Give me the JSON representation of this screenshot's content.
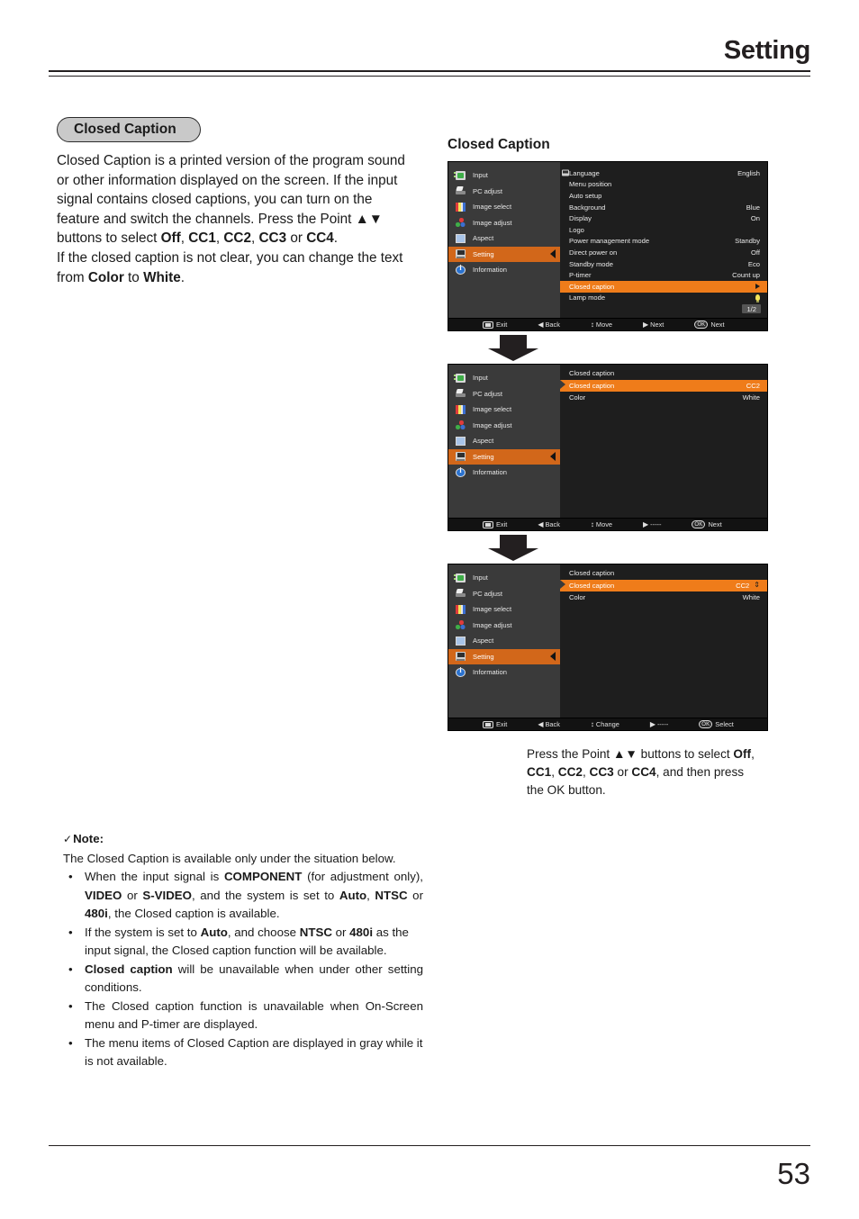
{
  "header": {
    "title": "Setting"
  },
  "footer": {
    "page_number": "53"
  },
  "left": {
    "badge_label": "Closed Caption",
    "paragraph_runs": [
      {
        "t": "Closed Caption is a printed version of the program sound or other information displayed on the screen. If the input signal contains closed captions, you can turn on the feature and switch the channels. Press the Point ",
        "b": false
      },
      {
        "t": "▲▼",
        "b": false
      },
      {
        "t": " buttons to select ",
        "b": false
      },
      {
        "t": "Off",
        "b": true
      },
      {
        "t": ", ",
        "b": false
      },
      {
        "t": "CC1",
        "b": true
      },
      {
        "t": ", ",
        "b": false
      },
      {
        "t": "CC2",
        "b": true
      },
      {
        "t": ", ",
        "b": false
      },
      {
        "t": "CC3",
        "b": true
      },
      {
        "t": " or ",
        "b": false
      },
      {
        "t": "CC4",
        "b": true
      },
      {
        "t": ".",
        "b": false
      }
    ],
    "paragraph_line2": "If the closed caption is not clear, you can change the text from ",
    "paragraph_line2_b1": "Color",
    "paragraph_line2_mid": " to ",
    "paragraph_line2_b2": "White",
    "paragraph_line2_end": "."
  },
  "note": {
    "tick": "✓",
    "heading": "Note:",
    "lead": "The Closed Caption is available only under the situation below.",
    "bullet_glyph": "•",
    "items": [
      {
        "parts": [
          {
            "t": "When the input signal is ",
            "b": false
          },
          {
            "t": "COMPONENT",
            "b": true
          },
          {
            "t": " (for adjustment only),  ",
            "b": false
          },
          {
            "t": "VIDEO",
            "b": true
          },
          {
            "t": " or ",
            "b": false
          },
          {
            "t": "S-VIDEO",
            "b": true
          },
          {
            "t": ", and the system is set to ",
            "b": false
          },
          {
            "t": "Auto",
            "b": true
          },
          {
            "t": ", ",
            "b": false
          },
          {
            "t": "NTSC",
            "b": true
          },
          {
            "t": " or ",
            "b": false
          },
          {
            "t": "480i",
            "b": true
          },
          {
            "t": ", the Closed caption is available.",
            "b": false
          }
        ],
        "justify": true
      },
      {
        "parts": [
          {
            "t": "If the system is set to ",
            "b": false
          },
          {
            "t": "Auto",
            "b": true
          },
          {
            "t": ", and choose ",
            "b": false
          },
          {
            "t": "NTSC",
            "b": true
          },
          {
            "t": " or ",
            "b": false
          },
          {
            "t": "480i",
            "b": true
          },
          {
            "t": " as the input signal, the Closed caption function will be available.",
            "b": false
          }
        ],
        "justify": false
      },
      {
        "parts": [
          {
            "t": "Closed caption",
            "b": true
          },
          {
            "t": " will be unavailable when under other setting conditions.",
            "b": false
          }
        ],
        "justify": true
      },
      {
        "parts": [
          {
            "t": "The Closed caption function is unavailable when On-Screen menu and P-timer are displayed.",
            "b": false
          }
        ],
        "justify": true
      },
      {
        "parts": [
          {
            "t": "The menu items of Closed Caption are displayed in gray while it is not available.",
            "b": false
          }
        ],
        "justify": false
      }
    ]
  },
  "right": {
    "title": "Closed Caption",
    "caption_parts": [
      {
        "t": "Press the Point ▲▼ buttons to select ",
        "b": false
      },
      {
        "t": "Off",
        "b": true
      },
      {
        "t": ", ",
        "b": false
      },
      {
        "t": "CC1",
        "b": true
      },
      {
        "t": ", ",
        "b": false
      },
      {
        "t": "CC2",
        "b": true
      },
      {
        "t": ", ",
        "b": false
      },
      {
        "t": "CC3",
        "b": true
      },
      {
        "t": " or ",
        "b": false
      },
      {
        "t": "CC4",
        "b": true
      },
      {
        "t": ", and then press the OK button.",
        "b": false
      }
    ]
  },
  "osd_sidebar_items": [
    {
      "label": "Input",
      "icon": "input-icon",
      "active": false
    },
    {
      "label": "PC adjust",
      "icon": "pc-adjust-icon",
      "active": false
    },
    {
      "label": "Image select",
      "icon": "image-select-icon",
      "active": false
    },
    {
      "label": "Image adjust",
      "icon": "image-adjust-icon",
      "active": false
    },
    {
      "label": "Aspect",
      "icon": "aspect-icon",
      "active": false
    },
    {
      "label": "Setting",
      "icon": "setting-icon",
      "active": true
    },
    {
      "label": "Information",
      "icon": "information-icon",
      "active": false
    }
  ],
  "osd1": {
    "rows": [
      {
        "name": "Language",
        "value": "English",
        "hl": false,
        "icon": true
      },
      {
        "name": "Menu position",
        "value": "",
        "hl": false
      },
      {
        "name": "Auto setup",
        "value": "",
        "hl": false
      },
      {
        "name": "Background",
        "value": "Blue",
        "hl": false
      },
      {
        "name": "Display",
        "value": "On",
        "hl": false
      },
      {
        "name": "Logo",
        "value": "",
        "hl": false
      },
      {
        "name": "Power management mode",
        "value": "Standby",
        "hl": false
      },
      {
        "name": "Direct power on",
        "value": "Off",
        "hl": false
      },
      {
        "name": "Standby mode",
        "value": "Eco",
        "hl": false
      },
      {
        "name": "P-timer",
        "value": "Count up",
        "hl": false
      },
      {
        "name": "Closed caption",
        "value": "",
        "hl": true,
        "arrow": true
      },
      {
        "name": "Lamp mode",
        "value": "",
        "hl": false,
        "bulb": true
      }
    ],
    "page_indicator": "1/2",
    "bar": {
      "exit": "Exit",
      "back": "Back",
      "move": "Move",
      "next": "Next",
      "ok_label": "OK",
      "ok_action": "Next",
      "left_glyph": "◀",
      "ud_glyph": "↕",
      "right_glyph": "▶"
    }
  },
  "osd2": {
    "header": "Closed caption",
    "rows": [
      {
        "name": "Closed caption",
        "value": "CC2",
        "hl": true
      },
      {
        "name": "Color",
        "value": "White",
        "hl": false
      }
    ],
    "bar": {
      "exit": "Exit",
      "back": "Back",
      "move": "Move",
      "next": "-----",
      "ok_label": "OK",
      "ok_action": "Next",
      "left_glyph": "◀",
      "ud_glyph": "↕",
      "right_glyph": "▶"
    }
  },
  "osd3": {
    "header": "Closed caption",
    "rows": [
      {
        "name": "Closed caption",
        "value": "CC2",
        "hl": true,
        "updown": true
      },
      {
        "name": "Color",
        "value": "White",
        "hl": false
      }
    ],
    "bar": {
      "exit": "Exit",
      "back": "Back",
      "move": "Change",
      "next": "-----",
      "ok_label": "OK",
      "ok_action": "Select",
      "left_glyph": "◀",
      "ud_glyph": "↕",
      "right_glyph": "▶"
    }
  }
}
